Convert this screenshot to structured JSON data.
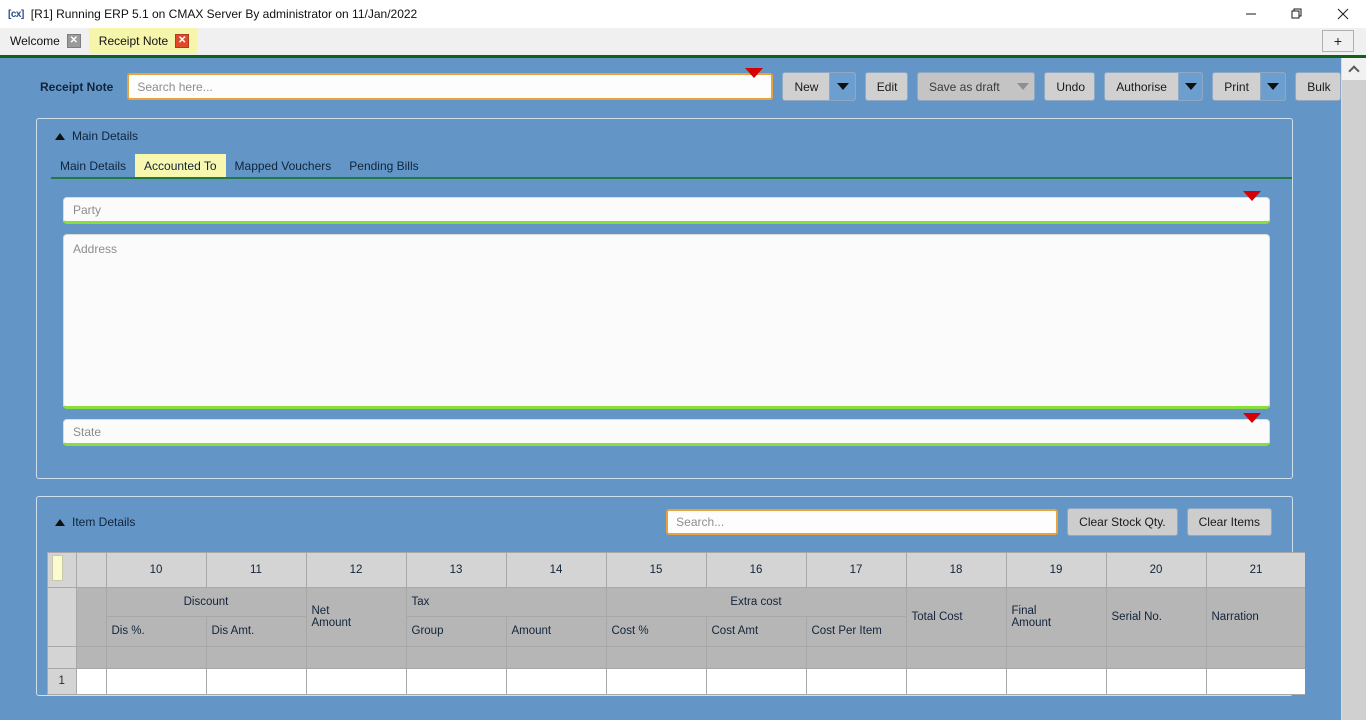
{
  "window": {
    "title": "[R1] Running ERP 5.1 on CMAX Server By administrator on 11/Jan/2022",
    "app_glyph": "[cx]",
    "minimize": "—",
    "restore": "❐",
    "close": "✕"
  },
  "tabs": {
    "items": [
      {
        "label": "Welcome",
        "active": false,
        "close": "✕"
      },
      {
        "label": "Receipt Note",
        "active": true,
        "close": "✕"
      }
    ],
    "add_label": "+"
  },
  "toolbar": {
    "module_label": "Receipt Note",
    "search_placeholder": "Search here...",
    "search_value": "",
    "buttons": [
      {
        "label": "New",
        "split": true,
        "disabled": false
      },
      {
        "label": "Edit",
        "split": false,
        "disabled": false
      },
      {
        "label": "Save as draft",
        "split": true,
        "disabled": true
      },
      {
        "label": "Undo",
        "split": false,
        "disabled": false
      },
      {
        "label": "Authorise",
        "split": true,
        "disabled": false
      },
      {
        "label": "Print",
        "split": true,
        "disabled": false
      },
      {
        "label": "Bulk",
        "split": false,
        "disabled": false
      }
    ]
  },
  "main_details": {
    "section_title": "Main Details",
    "subtabs": [
      {
        "label": "Main Details",
        "active": false
      },
      {
        "label": "Accounted To",
        "active": true
      },
      {
        "label": "Mapped Vouchers",
        "active": false
      },
      {
        "label": "Pending Bills",
        "active": false
      }
    ],
    "fields": {
      "party_placeholder": "Party",
      "party_value": "",
      "address_placeholder": "Address",
      "address_value": "",
      "state_placeholder": "State",
      "state_value": ""
    }
  },
  "item_details": {
    "section_title": "Item Details",
    "search_placeholder": "Search...",
    "search_value": "",
    "clear_stock_qty_label": "Clear Stock Qty.",
    "clear_items_label": "Clear Items",
    "grid": {
      "column_numbers": [
        "",
        "",
        "10",
        "11",
        "12",
        "13",
        "14",
        "15",
        "16",
        "17",
        "18",
        "19",
        "20",
        "21"
      ],
      "group_headers": [
        {
          "label": "",
          "span": 1
        },
        {
          "label": "",
          "span": 1
        },
        {
          "label": "Discount",
          "span": 2
        },
        {
          "label": "Net\nAmount",
          "span": 1
        },
        {
          "label": "Tax",
          "span": 2
        },
        {
          "label": "Extra cost",
          "span": 3
        },
        {
          "label": "Total Cost",
          "span": 1
        },
        {
          "label": "Final\nAmount",
          "span": 1
        },
        {
          "label": "Serial No.",
          "span": 1
        },
        {
          "label": "Narration",
          "span": 1
        }
      ],
      "sub_headers": [
        "",
        "",
        "Dis %.",
        "Dis Amt.",
        "",
        "Group",
        "Amount",
        "Cost %",
        "Cost Amt",
        "Cost Per Item",
        "",
        "",
        "",
        ""
      ],
      "rows": [
        {
          "number": "1",
          "cells": [
            "",
            "",
            "",
            "",
            "",
            "",
            "",
            "",
            "",
            "",
            "",
            "",
            ""
          ]
        }
      ]
    }
  },
  "colors": {
    "app_background": "#6396c6",
    "accent_green": "#1f7a43",
    "field_underline": "#8ade3c",
    "search_border": "#e8a33d",
    "active_tab": "#f5f5ab",
    "dropdown_arrow": "#d60000",
    "split_button": "#6c9fd0"
  }
}
